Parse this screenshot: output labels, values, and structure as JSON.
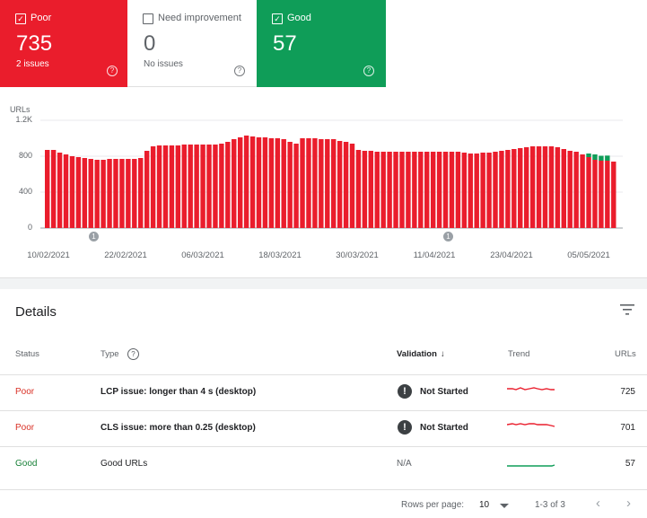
{
  "summary": {
    "poor": {
      "label": "Poor",
      "count": "735",
      "sub": "2 issues",
      "checked": true,
      "color": "#ea1d2c"
    },
    "need": {
      "label": "Need improvement",
      "count": "0",
      "sub": "No issues",
      "checked": false
    },
    "good": {
      "label": "Good",
      "count": "57",
      "checked": true,
      "color": "#0f9d58"
    }
  },
  "chart_data": {
    "type": "bar",
    "ylabel": "URLs",
    "yticks": [
      "1.2K",
      "800",
      "400",
      "0"
    ],
    "ylim": [
      0,
      1200
    ],
    "xticks": [
      "10/02/2021",
      "22/02/2021",
      "06/03/2021",
      "18/03/2021",
      "30/03/2021",
      "11/04/2021",
      "23/04/2021",
      "05/05/2021"
    ],
    "annotations": [
      "1",
      "1"
    ],
    "series": [
      {
        "name": "Poor",
        "color": "#ea1d2c",
        "values": [
          870,
          870,
          840,
          820,
          800,
          790,
          780,
          770,
          760,
          760,
          770,
          770,
          770,
          770,
          770,
          780,
          860,
          910,
          920,
          920,
          920,
          920,
          930,
          930,
          930,
          930,
          930,
          930,
          940,
          960,
          990,
          1010,
          1030,
          1020,
          1010,
          1010,
          1000,
          1000,
          990,
          960,
          940,
          1000,
          1000,
          1000,
          990,
          990,
          990,
          970,
          960,
          940,
          870,
          860,
          860,
          850,
          850,
          850,
          850,
          850,
          850,
          850,
          850,
          850,
          850,
          850,
          850,
          850,
          850,
          840,
          830,
          830,
          840,
          840,
          850,
          860,
          870,
          880,
          890,
          900,
          910,
          910,
          910,
          910,
          900,
          880,
          860,
          850,
          820,
          790,
          760,
          750,
          750,
          740
        ]
      },
      {
        "name": "Good",
        "color": "#0f9d58",
        "values": [
          0,
          0,
          0,
          0,
          0,
          0,
          0,
          0,
          0,
          0,
          0,
          0,
          0,
          0,
          0,
          0,
          0,
          0,
          0,
          0,
          0,
          0,
          0,
          0,
          0,
          0,
          0,
          0,
          0,
          0,
          0,
          0,
          0,
          0,
          0,
          0,
          0,
          0,
          0,
          0,
          0,
          0,
          0,
          0,
          0,
          0,
          0,
          0,
          0,
          0,
          0,
          0,
          0,
          0,
          0,
          0,
          0,
          0,
          0,
          0,
          0,
          0,
          0,
          0,
          0,
          0,
          0,
          0,
          0,
          0,
          0,
          0,
          0,
          0,
          0,
          0,
          0,
          0,
          0,
          0,
          0,
          0,
          0,
          0,
          0,
          0,
          0,
          40,
          60,
          55,
          57,
          0
        ]
      }
    ]
  },
  "details": {
    "title": "Details",
    "columns": {
      "status": "Status",
      "type": "Type",
      "validation": "Validation",
      "trend": "Trend",
      "urls": "URLs"
    },
    "rows": [
      {
        "status": "Poor",
        "type": "LCP issue: longer than 4 s (desktop)",
        "validation": "Not Started",
        "urls": "725"
      },
      {
        "status": "Poor",
        "type": "CLS issue: more than 0.25 (desktop)",
        "validation": "Not Started",
        "urls": "701"
      },
      {
        "status": "Good",
        "type": "Good URLs",
        "validation": "N/A",
        "urls": "57"
      }
    ]
  },
  "pager": {
    "rows_label": "Rows per page:",
    "rows_value": "10",
    "range": "1-3 of 3",
    "prev": "‹",
    "next": "›"
  }
}
